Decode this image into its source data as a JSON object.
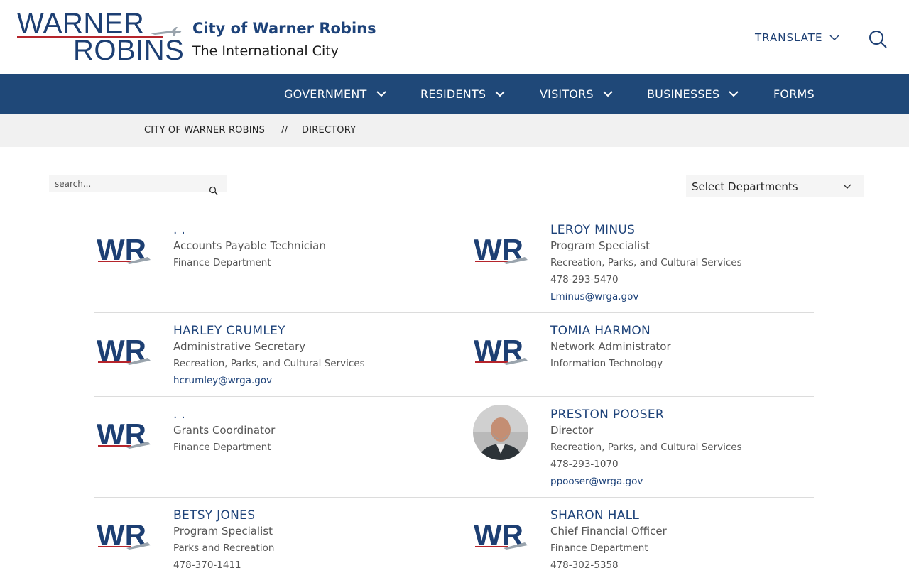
{
  "header": {
    "logo_line1": "WARNER",
    "logo_line2": "ROBINS",
    "site_title": "City of Warner Robins",
    "site_subtitle": "The International City",
    "translate_label": "TRANSLATE"
  },
  "nav": {
    "items": [
      {
        "label": "GOVERNMENT"
      },
      {
        "label": "RESIDENTS"
      },
      {
        "label": "VISITORS"
      },
      {
        "label": "BUSINESSES"
      },
      {
        "label": "FORMS"
      }
    ]
  },
  "breadcrumb": {
    "home": "CITY OF WARNER ROBINS",
    "separator": "//",
    "current": "DIRECTORY"
  },
  "filters": {
    "search_placeholder": "search...",
    "department_selected": "Select Departments"
  },
  "directory": [
    {
      "name": ". .",
      "title": "Accounts Payable Technician",
      "department": "Finance Department",
      "phone": "",
      "email": ""
    },
    {
      "name": "LEROY MINUS",
      "title": "Program Specialist",
      "department": "Recreation, Parks, and Cultural Services",
      "phone": "478-293-5470",
      "email": "Lminus@wrga.gov"
    },
    {
      "name": "HARLEY CRUMLEY",
      "title": "Administrative Secretary",
      "department": "Recreation, Parks, and Cultural Services",
      "phone": "",
      "email": "hcrumley@wrga.gov"
    },
    {
      "name": "TOMIA HARMON",
      "title": "Network Administrator",
      "department": "Information Technology",
      "phone": "",
      "email": ""
    },
    {
      "name": ". .",
      "title": "Grants Coordinator",
      "department": "Finance Department",
      "phone": "",
      "email": ""
    },
    {
      "name": "PRESTON POOSER",
      "title": "Director",
      "department": "Recreation, Parks, and Cultural Services",
      "phone": "478-293-1070",
      "email": "ppooser@wrga.gov"
    },
    {
      "name": "BETSY JONES",
      "title": "Program Specialist",
      "department": "Parks and Recreation",
      "phone": "478-370-1411",
      "email": ""
    },
    {
      "name": "SHARON HALL",
      "title": "Chief Financial Officer",
      "department": "Finance Department",
      "phone": "478-302-5358",
      "email": ""
    }
  ],
  "logo_badge_text": "WR",
  "colors": {
    "brand_blue": "#1d3f73",
    "nav_blue": "#1f4878",
    "accent_red": "#b5242b"
  }
}
